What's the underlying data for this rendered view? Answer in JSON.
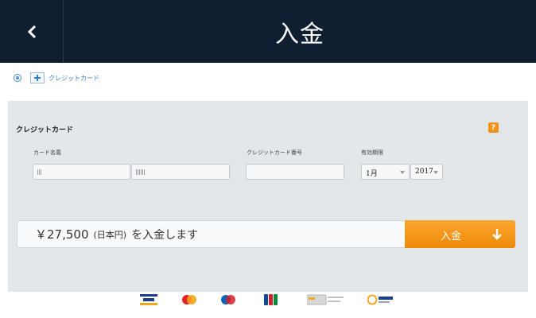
{
  "header": {
    "title": "入金",
    "back_icon": "chevron-left-icon"
  },
  "payment_method": {
    "label": "クレジットカード",
    "selected": true,
    "icon": "plus-icon"
  },
  "form": {
    "title": "クレジットカード",
    "help_label": "?",
    "cardholder_label": "カード名義",
    "card_number_label": "クレジットカード番号",
    "expiry_label": "有効期限",
    "expiry_month": "1月",
    "expiry_year": "2017"
  },
  "deposit": {
    "amount": "￥27,500",
    "currency": "(日本円)",
    "text": "を入金します",
    "button_label": "入金",
    "button_icon": "arrow-down-icon"
  },
  "card_brands": [
    "visa",
    "mastercard",
    "maestro",
    "jcb",
    "credit-cards",
    "qiwi-visa"
  ],
  "colors": {
    "header_bg": "#0f1e31",
    "accent_orange": "#f5991c",
    "link_blue": "#3b7fc4",
    "panel_bg": "#e4e7ea"
  }
}
